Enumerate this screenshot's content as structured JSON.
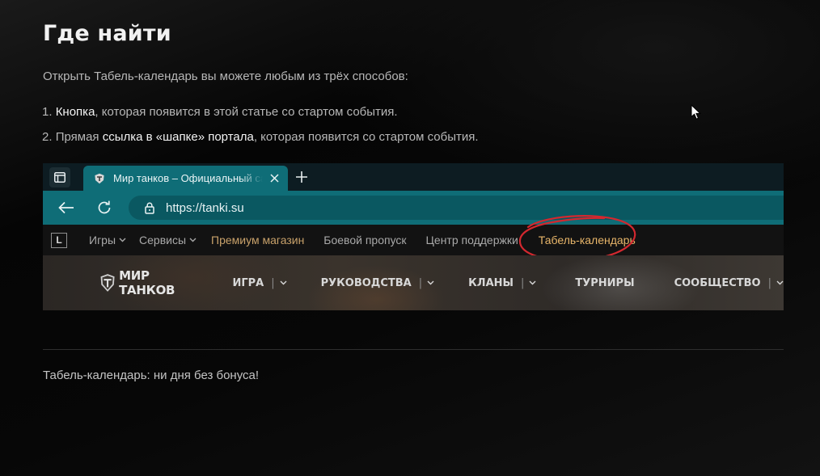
{
  "article": {
    "title": "Где найти",
    "intro": "Открыть Табель-календарь вы можете любым из трёх способов:",
    "list": [
      {
        "num": "1.",
        "highlight": "Кнопка",
        "rest": ", которая появится в этой статье со стартом события."
      },
      {
        "num": "2.",
        "pre": "Прямая ",
        "highlight": "ссылка в «шапке» портала",
        "rest": ", которая появится со стартом события."
      }
    ],
    "footer_link": "Табель-календарь: ни дня без бонуса!"
  },
  "screenshot": {
    "tab": {
      "title": "Мир танков – Официальный сайт"
    },
    "url": "https://tanki.su",
    "portal_logo": "L",
    "portal_nav": [
      {
        "label": "Игры",
        "dropdown": true
      },
      {
        "label": "Сервисы",
        "dropdown": true
      },
      {
        "label": "Премиум магазин"
      },
      {
        "label": "Боевой пропуск"
      },
      {
        "label": "Центр поддержки"
      },
      {
        "label": "Табель-календарь"
      }
    ],
    "game_logo": "МИР ТАНКОВ",
    "game_nav": [
      "ИГРА",
      "РУКОВОДСТВА",
      "КЛАНЫ",
      "ТУРНИРЫ",
      "СООБЩЕСТВО"
    ],
    "colors": {
      "toolbar": "#0f6d77",
      "premium": "#c8a16a",
      "calendar": "#e8b66a",
      "annotation": "#d3282f"
    }
  },
  "icons": [
    "sidebar-icon",
    "tank-favicon-icon",
    "close-icon",
    "plus-icon",
    "arrow-left-icon",
    "reload-icon",
    "lock-icon",
    "chevron-down-icon",
    "game-shield-icon",
    "mouse-cursor-icon"
  ]
}
